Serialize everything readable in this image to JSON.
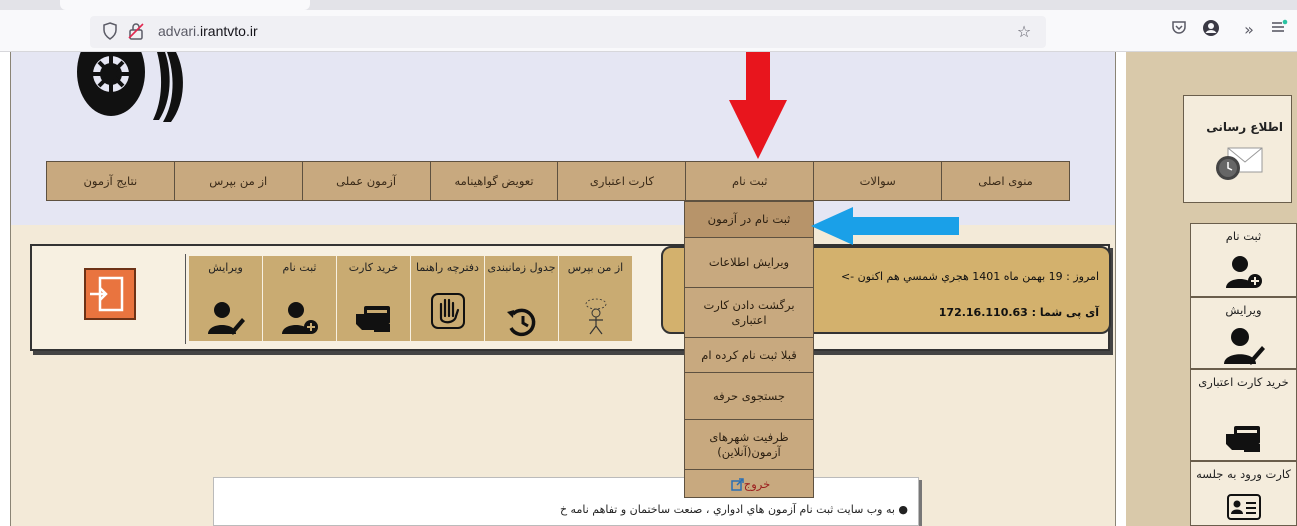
{
  "browser": {
    "url_prefix": "advari.",
    "url_domain": "irantvto.ir",
    "icons": [
      "shield-icon",
      "lock-icon",
      "star-icon",
      "pocket-icon",
      "account-icon",
      "overflow-icon",
      "menu-icon"
    ]
  },
  "top_menu": [
    {
      "label": "منوی اصلی"
    },
    {
      "label": "سوالات"
    },
    {
      "label": "ثبت نام"
    },
    {
      "label": "کارت اعتباری"
    },
    {
      "label": "تعویض گواهینامه"
    },
    {
      "label": "آزمون عملی"
    },
    {
      "label": "از من بپرس"
    },
    {
      "label": "نتایج آزمون"
    }
  ],
  "dropdown": {
    "items": [
      {
        "label": "ثبت نام در آزمون"
      },
      {
        "label": "ویرایش اطلاعات"
      },
      {
        "label": "برگشت دادن کارت اعتباری"
      },
      {
        "label": "قبلا ثبت نام کرده ام"
      },
      {
        "label": "جستجوی حرفه"
      },
      {
        "label": "ظرفیت شهرهای آزمون(آنلاین)"
      }
    ],
    "exit": "خروج"
  },
  "quick": {
    "buttons": [
      {
        "label": "ویرایش",
        "icon": "user-edit-icon"
      },
      {
        "label": "ثبت نام",
        "icon": "user-add-icon"
      },
      {
        "label": "خرید کارت",
        "icon": "card-hand-icon"
      },
      {
        "label": "دفترچه راهنما",
        "icon": "hand-icon"
      },
      {
        "label": "جدول زمانبندی",
        "icon": "clock-history-icon"
      },
      {
        "label": "از من بپرس",
        "icon": "thinking-person-icon"
      }
    ],
    "date": "امروز : 19 بهمن ماه 1401 هجري شمسي   هم اكنون ->",
    "ip": "آی پی شما : 172.16.110.63"
  },
  "news": {
    "line": "● به وب سایت ثبت نام آزمون هاي ادواري ، صنعت ساختمان و تفاهم نامه خ"
  },
  "right": {
    "notify_title": "اطلاع رسانی",
    "side_buttons": [
      {
        "label": "ثبت نام",
        "icon": "user-add-icon"
      },
      {
        "label": "ویرایش",
        "icon": "user-edit-icon"
      },
      {
        "label": "خرید کارت اعتباری",
        "icon": "card-hand-icon"
      },
      {
        "label": "کارت ورود به جلسه",
        "icon": "id-card-icon"
      }
    ]
  },
  "colors": {
    "menu": "#c8a97f",
    "red_arrow": "#e8151d",
    "blue_arrow": "#1aa0e8"
  }
}
